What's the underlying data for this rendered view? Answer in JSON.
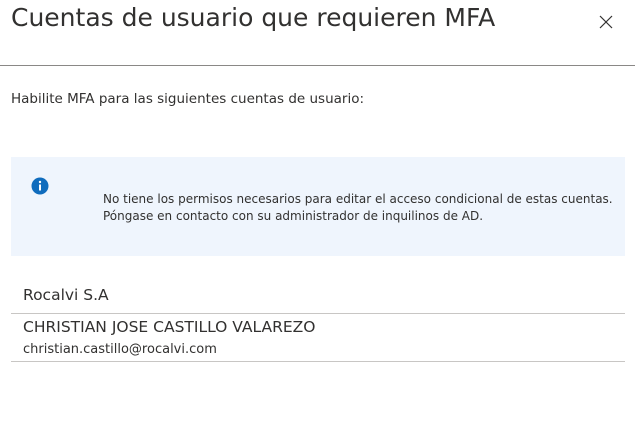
{
  "dialog": {
    "title": "Cuentas de usuario que requieren MFA",
    "close_icon": "close-icon"
  },
  "subtitle": "Habilite MFA para las siguientes cuentas de usuario:",
  "info_box": {
    "icon": "info-icon",
    "icon_color": "#0f6cbd",
    "background": "#eff5fd",
    "line1": "No tiene los permisos necesarios para editar el acceso condicional de estas cuentas.",
    "line2": "Póngase en contacto con su administrador de inquilinos de AD."
  },
  "organization": {
    "name": "Rocalvi S.A"
  },
  "users": [
    {
      "display_name": "CHRISTIAN JOSE CASTILLO VALAREZO",
      "email": "christian.castillo@rocalvi.com"
    }
  ]
}
